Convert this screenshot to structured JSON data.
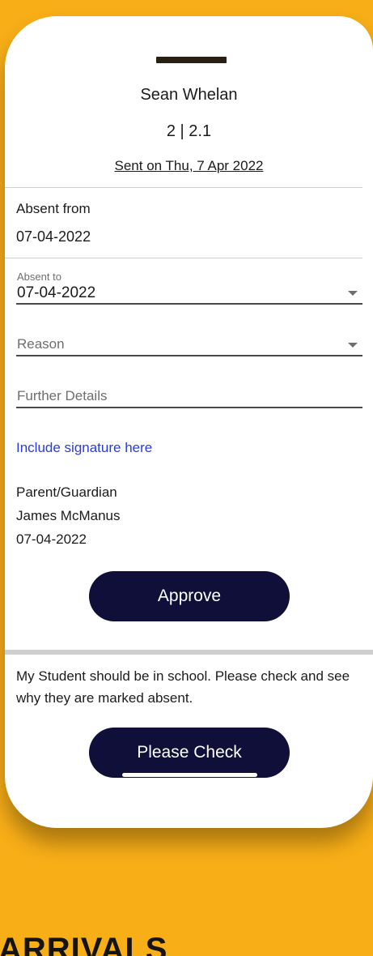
{
  "header": {
    "student_name": "Sean Whelan",
    "class_label": "2 | 2.1",
    "sent_date": "Sent on Thu, 7 Apr 2022"
  },
  "form": {
    "absent_from": {
      "label": "Absent from",
      "value": "07-04-2022"
    },
    "absent_to": {
      "label": "Absent to",
      "value": "07-04-2022"
    },
    "reason": {
      "placeholder": "Reason"
    },
    "further_details": {
      "placeholder": "Further Details"
    },
    "signature_link": "Include signature here",
    "guardian": {
      "heading": "Parent/Guardian",
      "name": "James McManus",
      "date": "07-04-2022"
    },
    "approve_label": "Approve"
  },
  "message": {
    "text": "My Student should be in school. Please check and see why they are marked absent.",
    "button_label": "Please Check"
  },
  "banner": {
    "text": "ARRIVALS"
  },
  "colors": {
    "background": "#f8ae17",
    "button": "#0f0f3a",
    "link": "#2a3be0"
  }
}
